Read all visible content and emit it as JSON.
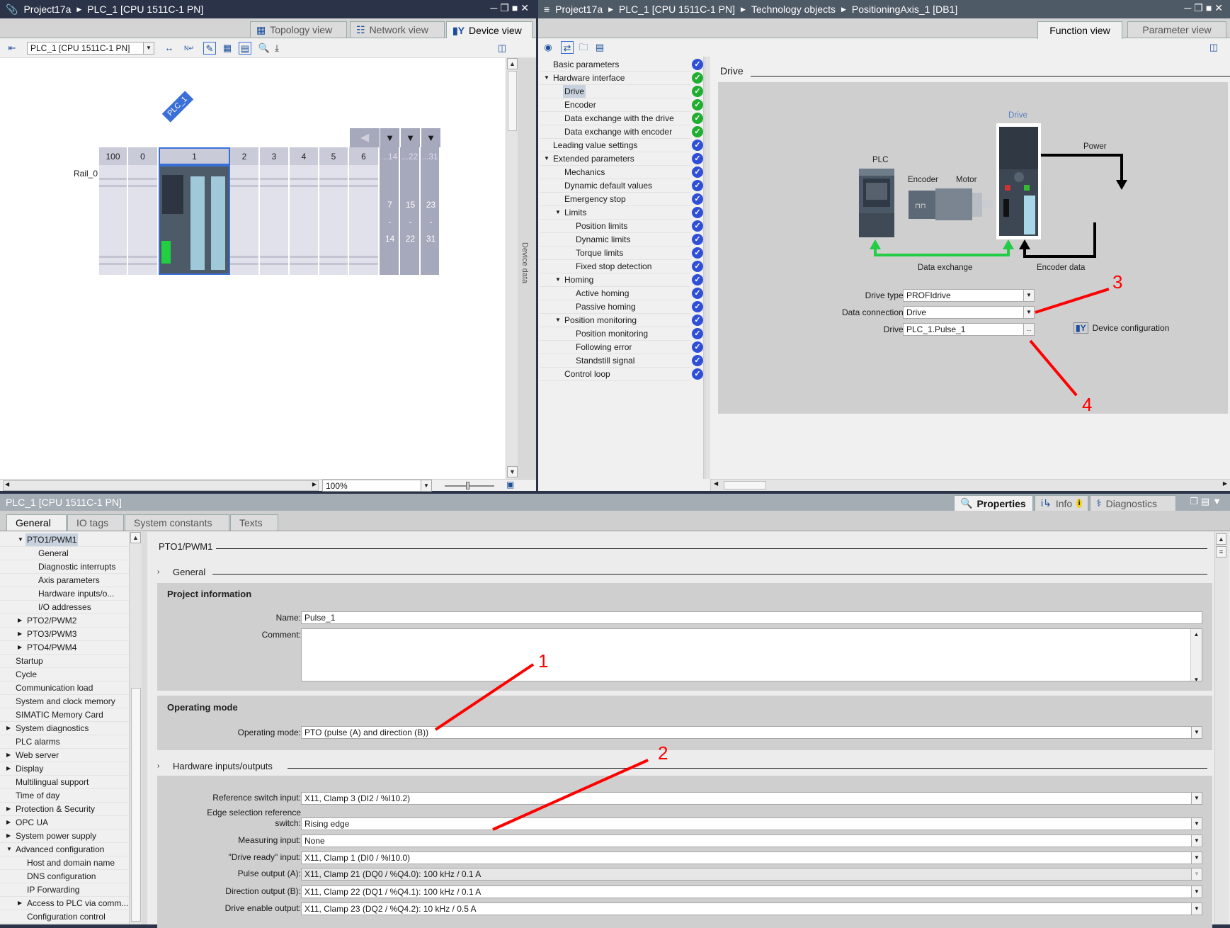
{
  "left_panel": {
    "breadcrumb": [
      "Project17a",
      "PLC_1 [CPU 1511C-1 PN]"
    ],
    "view_tabs": [
      {
        "label": "Topology view",
        "icon": "topology-icon",
        "active": false
      },
      {
        "label": "Network view",
        "icon": "network-icon",
        "active": false
      },
      {
        "label": "Device view",
        "icon": "device-icon",
        "active": true
      }
    ],
    "device_select": "PLC_1 [CPU 1511C-1 PN]",
    "device_tag": "PLC_1",
    "rail_label": "Rail_0",
    "slots": [
      "100",
      "0",
      "1",
      "2",
      "3",
      "4",
      "5",
      "6",
      "...14",
      "...22",
      "...31"
    ],
    "slot_ranges": [
      [
        "7",
        "-",
        "14"
      ],
      [
        "15",
        "-",
        "22"
      ],
      [
        "23",
        "-",
        "31"
      ]
    ],
    "zoom_level": "100%",
    "side_tab": "Device data"
  },
  "right_panel": {
    "breadcrumb": [
      "Project17a",
      "PLC_1 [CPU 1511C-1 PN]",
      "Technology objects",
      "PositioningAxis_1 [DB1]"
    ],
    "view_tabs": [
      {
        "label": "Function view",
        "active": true
      },
      {
        "label": "Parameter view",
        "active": false
      }
    ],
    "nav": [
      {
        "label": "Basic parameters",
        "level": 0,
        "arrow": "",
        "status": "blue"
      },
      {
        "label": "Hardware interface",
        "level": 0,
        "arrow": "down",
        "status": "green"
      },
      {
        "label": "Drive",
        "level": 1,
        "arrow": "",
        "status": "green",
        "selected": true
      },
      {
        "label": "Encoder",
        "level": 1,
        "arrow": "",
        "status": "green"
      },
      {
        "label": "Data exchange with the drive",
        "level": 1,
        "arrow": "",
        "status": "green"
      },
      {
        "label": "Data exchange with encoder",
        "level": 1,
        "arrow": "",
        "status": "green"
      },
      {
        "label": "Leading value settings",
        "level": 0,
        "arrow": "",
        "status": "blue"
      },
      {
        "label": "Extended parameters",
        "level": 0,
        "arrow": "down",
        "status": "blue"
      },
      {
        "label": "Mechanics",
        "level": 1,
        "arrow": "",
        "status": "blue"
      },
      {
        "label": "Dynamic default values",
        "level": 1,
        "arrow": "",
        "status": "blue"
      },
      {
        "label": "Emergency stop",
        "level": 1,
        "arrow": "",
        "status": "blue"
      },
      {
        "label": "Limits",
        "level": 1,
        "arrow": "down",
        "status": "blue"
      },
      {
        "label": "Position limits",
        "level": 2,
        "arrow": "",
        "status": "blue"
      },
      {
        "label": "Dynamic limits",
        "level": 2,
        "arrow": "",
        "status": "blue"
      },
      {
        "label": "Torque limits",
        "level": 2,
        "arrow": "",
        "status": "blue"
      },
      {
        "label": "Fixed stop detection",
        "level": 2,
        "arrow": "",
        "status": "blue"
      },
      {
        "label": "Homing",
        "level": 1,
        "arrow": "down",
        "status": "blue"
      },
      {
        "label": "Active homing",
        "level": 2,
        "arrow": "",
        "status": "blue"
      },
      {
        "label": "Passive homing",
        "level": 2,
        "arrow": "",
        "status": "blue"
      },
      {
        "label": "Position monitoring",
        "level": 1,
        "arrow": "down",
        "status": "blue"
      },
      {
        "label": "Position monitoring",
        "level": 2,
        "arrow": "",
        "status": "blue"
      },
      {
        "label": "Following error",
        "level": 2,
        "arrow": "",
        "status": "blue"
      },
      {
        "label": "Standstill signal",
        "level": 2,
        "arrow": "",
        "status": "blue"
      },
      {
        "label": "Control loop",
        "level": 1,
        "arrow": "",
        "status": "blue"
      }
    ],
    "section_title": "Drive",
    "diagram": {
      "plc_label": "PLC",
      "drive_label": "Drive",
      "power_label": "Power",
      "encoder_label": "Encoder",
      "motor_label": "Motor",
      "data_exchange_label": "Data exchange",
      "encoder_data_label": "Encoder data"
    },
    "form": {
      "drive_type_label": "Drive type:",
      "drive_type_value": "PROFIdrive",
      "data_connection_label": "Data connection:",
      "data_connection_value": "Drive",
      "drive_label": "Drive:",
      "drive_value": "PLC_1.Pulse_1",
      "browse_label": "...",
      "device_config_label": "Device configuration"
    }
  },
  "bottom_panel": {
    "title": "PLC_1 [CPU 1511C-1 PN]",
    "inspector_tabs": [
      {
        "label": "Properties",
        "active": true
      },
      {
        "label": "Info",
        "active": false
      },
      {
        "label": "Diagnostics",
        "active": false
      }
    ],
    "tabs": [
      {
        "label": "General",
        "active": true
      },
      {
        "label": "IO tags",
        "active": false
      },
      {
        "label": "System constants",
        "active": false
      },
      {
        "label": "Texts",
        "active": false
      }
    ],
    "tree": [
      {
        "label": "PTO1/PWM1",
        "level": 1,
        "arrow": "down",
        "selected": true
      },
      {
        "label": "General",
        "level": 2,
        "arrow": ""
      },
      {
        "label": "Diagnostic interrupts",
        "level": 2,
        "arrow": ""
      },
      {
        "label": "Axis parameters",
        "level": 2,
        "arrow": ""
      },
      {
        "label": "Hardware inputs/o...",
        "level": 2,
        "arrow": ""
      },
      {
        "label": "I/O addresses",
        "level": 2,
        "arrow": ""
      },
      {
        "label": "PTO2/PWM2",
        "level": 1,
        "arrow": "right"
      },
      {
        "label": "PTO3/PWM3",
        "level": 1,
        "arrow": "right"
      },
      {
        "label": "PTO4/PWM4",
        "level": 1,
        "arrow": "right"
      },
      {
        "label": "Startup",
        "level": 0,
        "arrow": ""
      },
      {
        "label": "Cycle",
        "level": 0,
        "arrow": ""
      },
      {
        "label": "Communication load",
        "level": 0,
        "arrow": ""
      },
      {
        "label": "System and clock memory",
        "level": 0,
        "arrow": ""
      },
      {
        "label": "SIMATIC Memory Card",
        "level": 0,
        "arrow": ""
      },
      {
        "label": "System diagnostics",
        "level": 0,
        "arrow": "right"
      },
      {
        "label": "PLC alarms",
        "level": 0,
        "arrow": ""
      },
      {
        "label": "Web server",
        "level": 0,
        "arrow": "right"
      },
      {
        "label": "Display",
        "level": 0,
        "arrow": "right"
      },
      {
        "label": "Multilingual support",
        "level": 0,
        "arrow": ""
      },
      {
        "label": "Time of day",
        "level": 0,
        "arrow": ""
      },
      {
        "label": "Protection & Security",
        "level": 0,
        "arrow": "right"
      },
      {
        "label": "OPC UA",
        "level": 0,
        "arrow": "right"
      },
      {
        "label": "System power supply",
        "level": 0,
        "arrow": "right"
      },
      {
        "label": "Advanced configuration",
        "level": 0,
        "arrow": "down"
      },
      {
        "label": "Host and domain name",
        "level": 1,
        "arrow": ""
      },
      {
        "label": "DNS configuration",
        "level": 1,
        "arrow": ""
      },
      {
        "label": "IP Forwarding",
        "level": 1,
        "arrow": ""
      },
      {
        "label": "Access to PLC via comm...",
        "level": 1,
        "arrow": "right"
      },
      {
        "label": "Configuration control",
        "level": 1,
        "arrow": ""
      }
    ],
    "content": {
      "heading": "PTO1/PWM1",
      "general_section": "General",
      "project_info_title": "Project information",
      "name_label": "Name:",
      "name_value": "Pulse_1",
      "comment_label": "Comment:",
      "comment_value": "",
      "operating_mode_title": "Operating mode",
      "operating_mode_label": "Operating mode:",
      "operating_mode_value": "PTO (pulse (A) and direction (B))",
      "hw_section": "Hardware inputs/outputs",
      "hw_fields": [
        {
          "label": "Reference switch input:",
          "value": "X11, Clamp 3 (DI2 / %I10.2)",
          "disabled": false
        },
        {
          "label": "Edge selection reference switch:",
          "value": "Rising edge",
          "disabled": false
        },
        {
          "label": "Measuring input:",
          "value": "None",
          "disabled": false
        },
        {
          "label": "\"Drive ready\" input:",
          "value": "X11, Clamp 1 (DI0 / %I10.0)",
          "disabled": false
        },
        {
          "label": "Pulse output (A):",
          "value": "X11, Clamp 21 (DQ0 / %Q4.0): 100 kHz / 0.1 A",
          "disabled": true
        },
        {
          "label": "Direction output (B):",
          "value": "X11, Clamp 22 (DQ1 / %Q4.1): 100 kHz / 0.1 A",
          "disabled": false
        },
        {
          "label": "Drive enable output:",
          "value": "X11, Clamp 23 (DQ2 / %Q4.2): 10 kHz / 0.5 A",
          "disabled": false
        }
      ]
    }
  },
  "annotations": [
    "1",
    "2",
    "3",
    "4"
  ],
  "colors": {
    "title_bar": "#2b3348",
    "accent_blue": "#3a6fd8",
    "status_green": "#1fae2f",
    "status_blue": "#2f4fd8",
    "annotation_red": "#ff0000",
    "green_link": "#22cc44"
  }
}
